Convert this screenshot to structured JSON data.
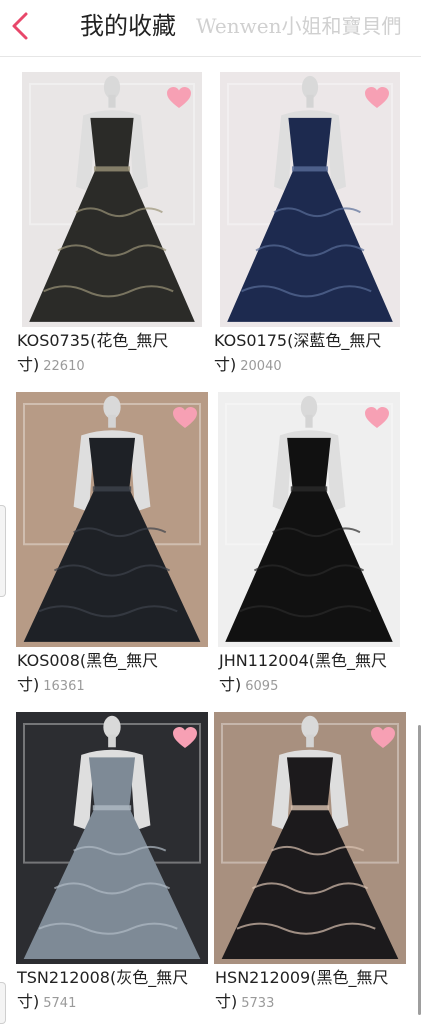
{
  "header": {
    "title": "我的收藏",
    "watermark": "Wenwen小姐和寶貝們"
  },
  "colors": {
    "accent": "#e8476a",
    "heart": "#f7a0b4"
  },
  "items": [
    {
      "name": "KOS0735(花色_無尺",
      "name_tail": "寸)",
      "count": "22610",
      "dress": "#2b2b28",
      "bg": "#e9e6e6",
      "pattern": "#9b9478"
    },
    {
      "name": "KOS0175(深藍色_無尺",
      "name_tail": "寸)",
      "count": "20040",
      "dress": "#1d2a4f",
      "bg": "#ece7e8",
      "pattern": "#5a6d99"
    },
    {
      "name": "KOS008(黑色_無尺",
      "name_tail": "寸)",
      "count": "16361",
      "dress": "#1e2126",
      "bg": "#b79b86",
      "pattern": "#3d434c"
    },
    {
      "name": "JHN112004(黑色_無尺",
      "name_tail": "寸)",
      "count": "6095",
      "dress": "#111111",
      "bg": "#efefef",
      "pattern": "#2a2a2a"
    },
    {
      "name": "TSN212008(灰色_無尺",
      "name_tail": "寸)",
      "count": "5741",
      "dress": "#7e8a96",
      "bg": "#2c2d31",
      "pattern": "#b0bac4"
    },
    {
      "name": "HSN212009(黑色_無尺",
      "name_tail": "寸)",
      "count": "5733",
      "dress": "#1c1a1c",
      "bg": "#a8907f",
      "pattern": "#d9c2b0"
    }
  ]
}
